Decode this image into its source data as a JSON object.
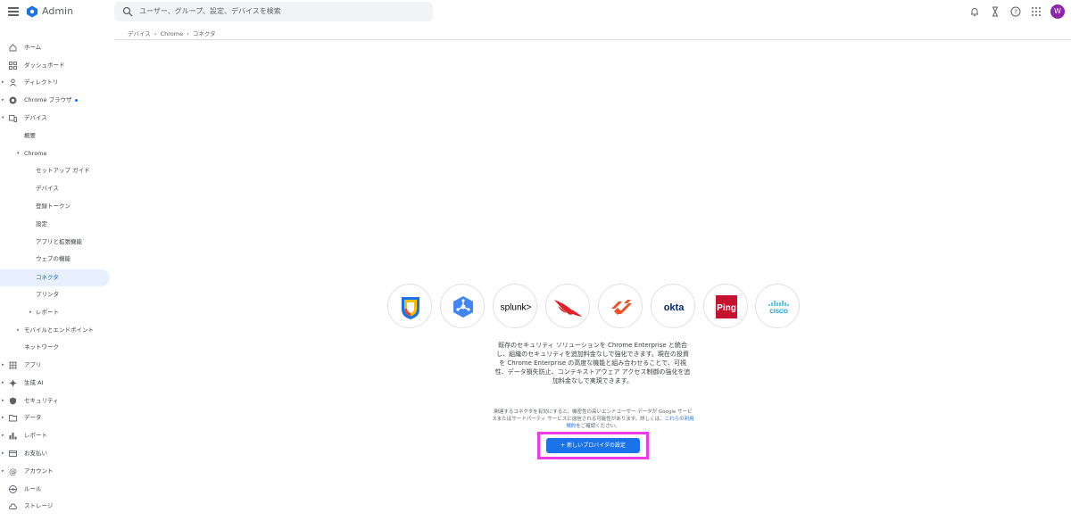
{
  "header": {
    "app_title": "Admin",
    "search_placeholder": "ユーザー、グループ、設定、デバイスを検索",
    "avatar_initial": "W",
    "icons": [
      "menu-icon",
      "google-admin-logo",
      "search-icon",
      "bell-icon",
      "hourglass-icon",
      "help-icon",
      "apps-grid-icon"
    ]
  },
  "breadcrumb": {
    "items": [
      "デバイス",
      "Chrome",
      "コネクタ"
    ],
    "separator": "›"
  },
  "sidebar": {
    "items": [
      {
        "label": "ホーム",
        "icon": "home-icon"
      },
      {
        "label": "ダッシュボード",
        "icon": "dashboard-icon"
      },
      {
        "label": "ディレクトリ",
        "icon": "person-icon"
      },
      {
        "label": "Chrome ブラウザ",
        "icon": "chrome-icon"
      },
      {
        "label": "デバイス",
        "icon": "devices-icon"
      },
      {
        "label": "概要"
      },
      {
        "label": "Chrome"
      },
      {
        "label": "セットアップ ガイド"
      },
      {
        "label": "デバイス"
      },
      {
        "label": "登録トークン"
      },
      {
        "label": "設定"
      },
      {
        "label": "アプリと拡張機能"
      },
      {
        "label": "ウェブの機能"
      },
      {
        "label": "コネクタ"
      },
      {
        "label": "プリンタ"
      },
      {
        "label": "レポート"
      },
      {
        "label": "モバイルとエンドポイント"
      },
      {
        "label": "ネットワーク"
      },
      {
        "label": "アプリ",
        "icon": "apps-icon"
      },
      {
        "label": "生成 AI",
        "icon": "sparkle-icon"
      },
      {
        "label": "セキュリティ",
        "icon": "shield-icon"
      },
      {
        "label": "データ",
        "icon": "folder-icon"
      },
      {
        "label": "レポート",
        "icon": "bar-chart-icon"
      },
      {
        "label": "お支払い",
        "icon": "credit-card-icon"
      },
      {
        "label": "アカウント",
        "icon": "at-icon"
      },
      {
        "label": "ルール",
        "icon": "rules-icon"
      },
      {
        "label": "ストレージ",
        "icon": "cloud-icon"
      }
    ],
    "active": "コネクタ",
    "accent_color": "#1a73e8"
  },
  "main": {
    "providers": [
      {
        "name": "Google",
        "icon": "google-shield-logo"
      },
      {
        "name": "Google Cloud",
        "icon": "google-cloud-logo"
      },
      {
        "name": "splunk>",
        "icon": "splunk-logo"
      },
      {
        "name": "CrowdStrike",
        "icon": "crowdstrike-logo"
      },
      {
        "name": "Palo Alto Networks",
        "icon": "paloalto-logo"
      },
      {
        "name": "okta",
        "icon": "okta-logo"
      },
      {
        "name": "Ping",
        "icon": "ping-identity-logo"
      },
      {
        "name": "cisco",
        "icon": "cisco-logo"
      }
    ],
    "description": "既存のセキュリティ ソリューションを Chrome Enterprise と統合し、組織のセキュリティを追加料金なしで強化できます。現在の投資を Chrome Enterprise の高度な機能と組み合わせることで、可視性、データ損失防止、コンテキストアウェア アクセス制御の強化を追加料金なしで実現できます。",
    "note_text": "関連するコネクタを有効にすると、機密性の高いエンドユーザー データが Google サービスまたはサードパーティ サービスに送信される可能性があります。詳しくは、",
    "note_link": "これらの利用規約",
    "note_tail": "をご確認ください。",
    "primary_button": "+ 新しいプロバイダの設定",
    "highlight_color": "#f03ae6"
  }
}
